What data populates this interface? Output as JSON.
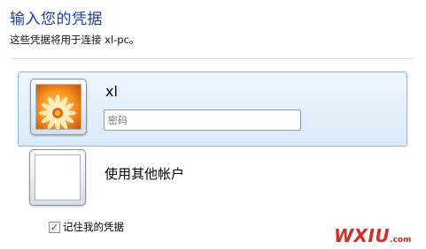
{
  "dialog": {
    "title": "输入您的凭据",
    "subtitle": "这些凭据将用于连接 xl-pc。"
  },
  "accounts": [
    {
      "username": "xl",
      "password_placeholder": "密码",
      "avatar": "orange-flower-picture"
    },
    {
      "label": "使用其他帐户",
      "avatar": "blank-picture"
    }
  ],
  "remember": {
    "checked": true,
    "label": "记住我的凭据"
  },
  "watermark": {
    "main": "WXIU",
    "suffix": ".com"
  },
  "colors": {
    "title": "#1a3f9c",
    "selection_border": "#8bb7e6",
    "watermark": "#d82b22"
  }
}
